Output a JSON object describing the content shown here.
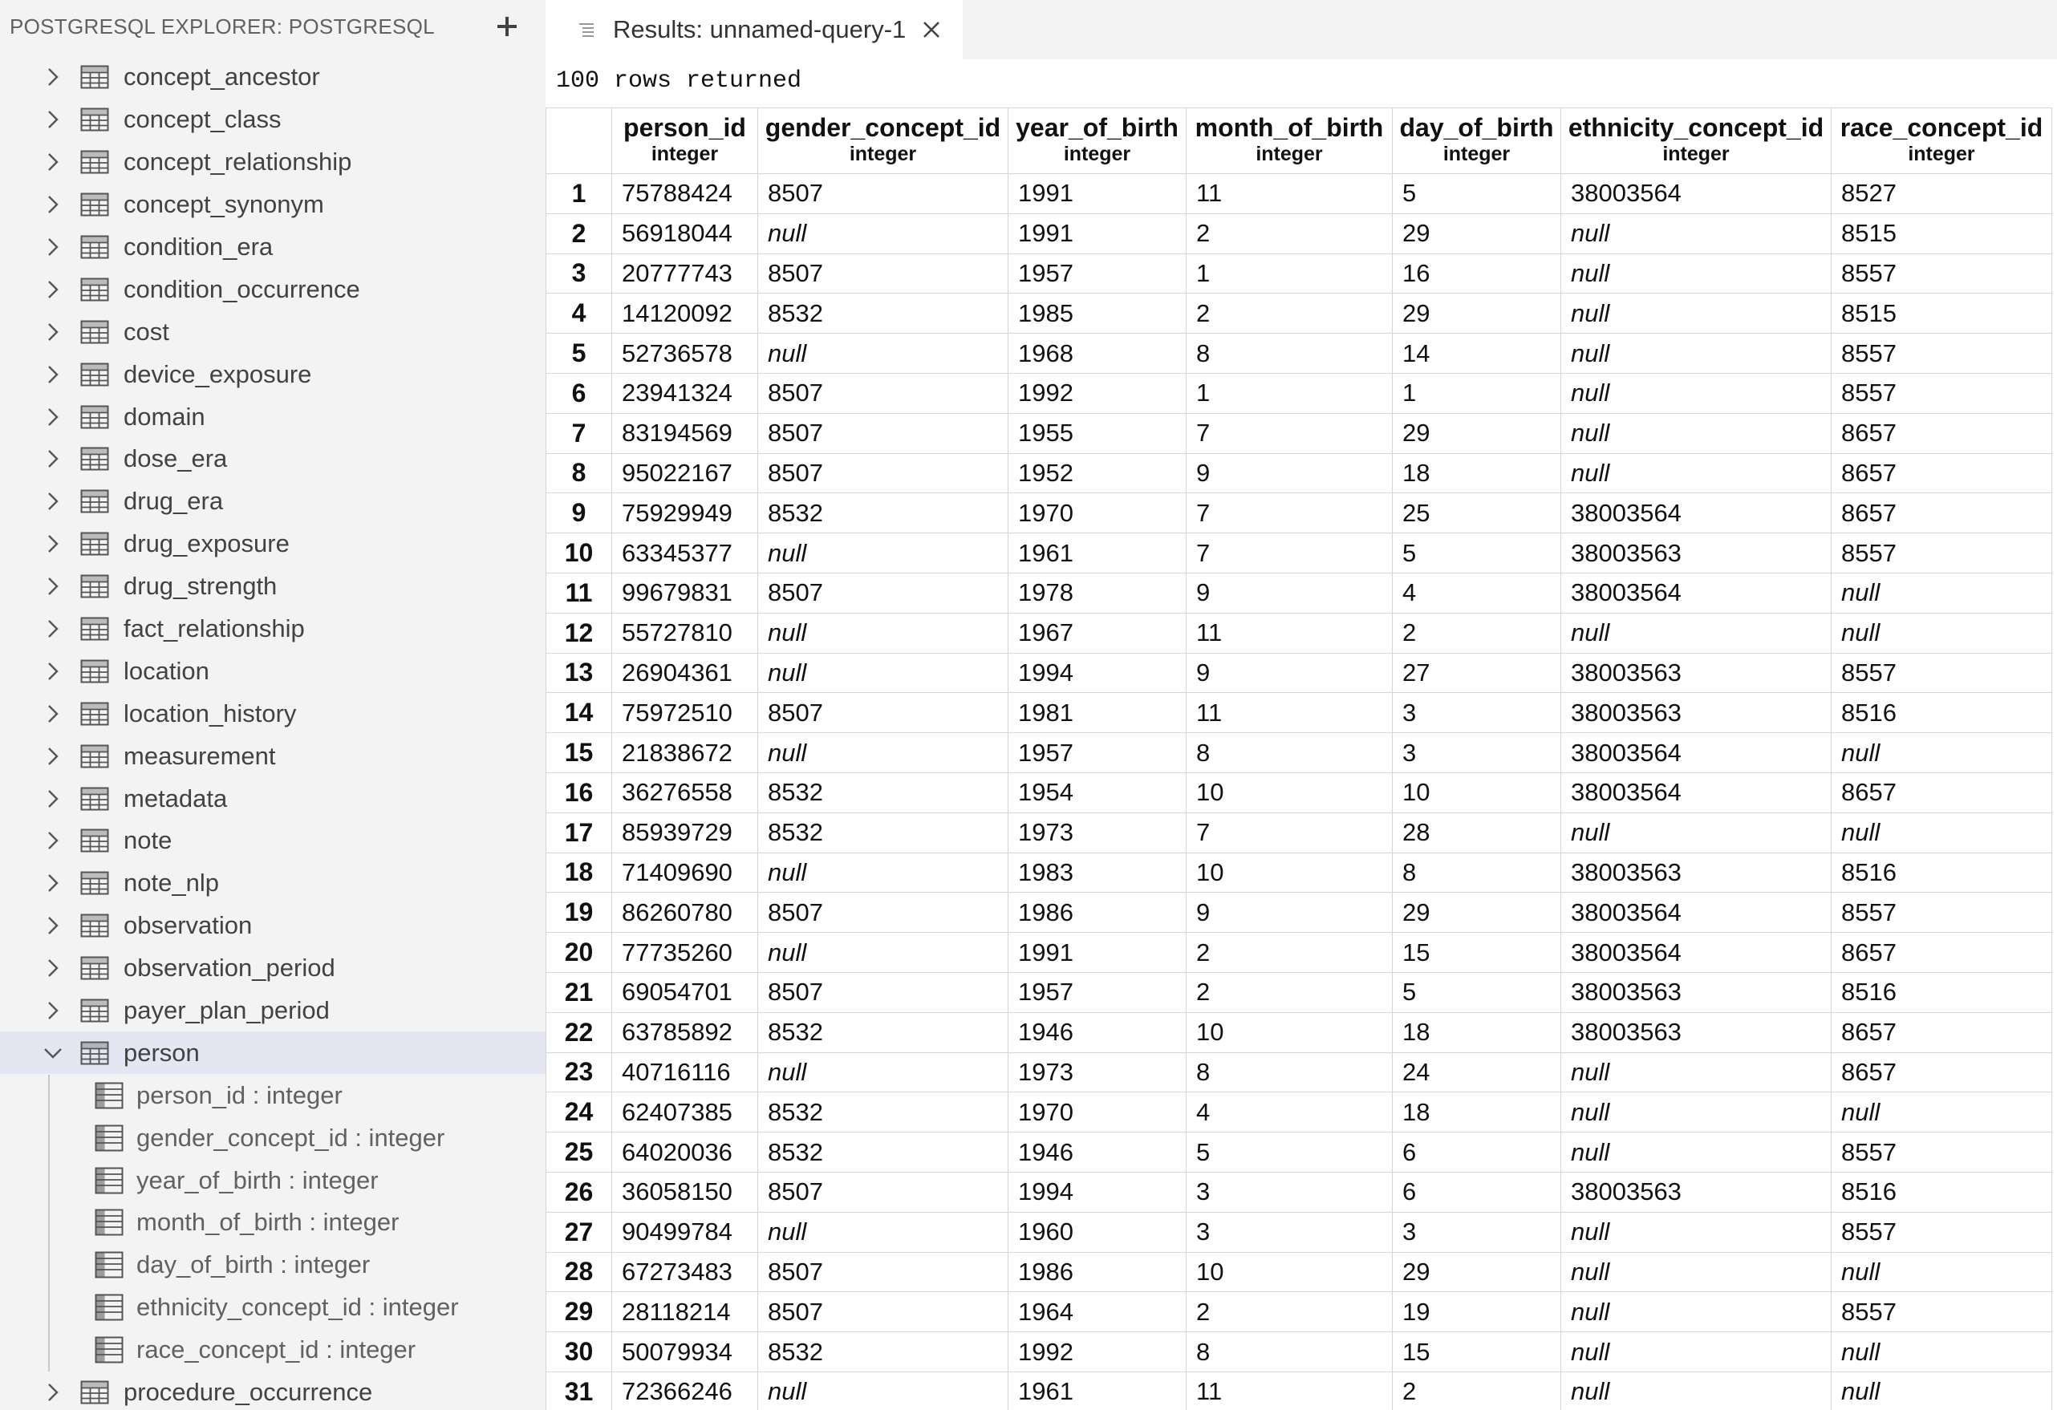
{
  "sidebar": {
    "title": "POSTGRESQL EXPLORER: POSTGRESQL",
    "tables_before": [
      "concept_ancestor",
      "concept_class",
      "concept_relationship",
      "concept_synonym",
      "condition_era",
      "condition_occurrence",
      "cost",
      "device_exposure",
      "domain",
      "dose_era",
      "drug_era",
      "drug_exposure",
      "drug_strength",
      "fact_relationship",
      "location",
      "location_history",
      "measurement",
      "metadata",
      "note",
      "note_nlp",
      "observation",
      "observation_period",
      "payer_plan_period"
    ],
    "expanded_table": "person",
    "columns": [
      "person_id : integer",
      "gender_concept_id : integer",
      "year_of_birth : integer",
      "month_of_birth : integer",
      "day_of_birth : integer",
      "ethnicity_concept_id : integer",
      "race_concept_id : integer"
    ],
    "tables_after": [
      "procedure_occurrence"
    ]
  },
  "tab": {
    "label": "Results: unnamed-query-1"
  },
  "results": {
    "summary": "100 rows returned",
    "columns": [
      {
        "name": "person_id",
        "type": "integer"
      },
      {
        "name": "gender_concept_id",
        "type": "integer"
      },
      {
        "name": "year_of_birth",
        "type": "integer"
      },
      {
        "name": "month_of_birth",
        "type": "integer"
      },
      {
        "name": "day_of_birth",
        "type": "integer"
      },
      {
        "name": "ethnicity_concept_id",
        "type": "integer"
      },
      {
        "name": "race_concept_id",
        "type": "integer"
      }
    ],
    "rows": [
      [
        "1",
        "75788424",
        "8507",
        "1991",
        "11",
        "5",
        "38003564",
        "8527"
      ],
      [
        "2",
        "56918044",
        "null",
        "1991",
        "2",
        "29",
        "null",
        "8515"
      ],
      [
        "3",
        "20777743",
        "8507",
        "1957",
        "1",
        "16",
        "null",
        "8557"
      ],
      [
        "4",
        "14120092",
        "8532",
        "1985",
        "2",
        "29",
        "null",
        "8515"
      ],
      [
        "5",
        "52736578",
        "null",
        "1968",
        "8",
        "14",
        "null",
        "8557"
      ],
      [
        "6",
        "23941324",
        "8507",
        "1992",
        "1",
        "1",
        "null",
        "8557"
      ],
      [
        "7",
        "83194569",
        "8507",
        "1955",
        "7",
        "29",
        "null",
        "8657"
      ],
      [
        "8",
        "95022167",
        "8507",
        "1952",
        "9",
        "18",
        "null",
        "8657"
      ],
      [
        "9",
        "75929949",
        "8532",
        "1970",
        "7",
        "25",
        "38003564",
        "8657"
      ],
      [
        "10",
        "63345377",
        "null",
        "1961",
        "7",
        "5",
        "38003563",
        "8557"
      ],
      [
        "11",
        "99679831",
        "8507",
        "1978",
        "9",
        "4",
        "38003564",
        "null"
      ],
      [
        "12",
        "55727810",
        "null",
        "1967",
        "11",
        "2",
        "null",
        "null"
      ],
      [
        "13",
        "26904361",
        "null",
        "1994",
        "9",
        "27",
        "38003563",
        "8557"
      ],
      [
        "14",
        "75972510",
        "8507",
        "1981",
        "11",
        "3",
        "38003563",
        "8516"
      ],
      [
        "15",
        "21838672",
        "null",
        "1957",
        "8",
        "3",
        "38003564",
        "null"
      ],
      [
        "16",
        "36276558",
        "8532",
        "1954",
        "10",
        "10",
        "38003564",
        "8657"
      ],
      [
        "17",
        "85939729",
        "8532",
        "1973",
        "7",
        "28",
        "null",
        "null"
      ],
      [
        "18",
        "71409690",
        "null",
        "1983",
        "10",
        "8",
        "38003563",
        "8516"
      ],
      [
        "19",
        "86260780",
        "8507",
        "1986",
        "9",
        "29",
        "38003564",
        "8557"
      ],
      [
        "20",
        "77735260",
        "null",
        "1991",
        "2",
        "15",
        "38003564",
        "8657"
      ],
      [
        "21",
        "69054701",
        "8507",
        "1957",
        "2",
        "5",
        "38003563",
        "8516"
      ],
      [
        "22",
        "63785892",
        "8532",
        "1946",
        "10",
        "18",
        "38003563",
        "8657"
      ],
      [
        "23",
        "40716116",
        "null",
        "1973",
        "8",
        "24",
        "null",
        "8657"
      ],
      [
        "24",
        "62407385",
        "8532",
        "1970",
        "4",
        "18",
        "null",
        "null"
      ],
      [
        "25",
        "64020036",
        "8532",
        "1946",
        "5",
        "6",
        "null",
        "8557"
      ],
      [
        "26",
        "36058150",
        "8507",
        "1994",
        "3",
        "6",
        "38003563",
        "8516"
      ],
      [
        "27",
        "90499784",
        "null",
        "1960",
        "3",
        "3",
        "null",
        "8557"
      ],
      [
        "28",
        "67273483",
        "8507",
        "1986",
        "10",
        "29",
        "null",
        "null"
      ],
      [
        "29",
        "28118214",
        "8507",
        "1964",
        "2",
        "19",
        "null",
        "8557"
      ],
      [
        "30",
        "50079934",
        "8532",
        "1992",
        "8",
        "15",
        "null",
        "null"
      ],
      [
        "31",
        "72366246",
        "null",
        "1961",
        "11",
        "2",
        "null",
        "null"
      ]
    ]
  }
}
